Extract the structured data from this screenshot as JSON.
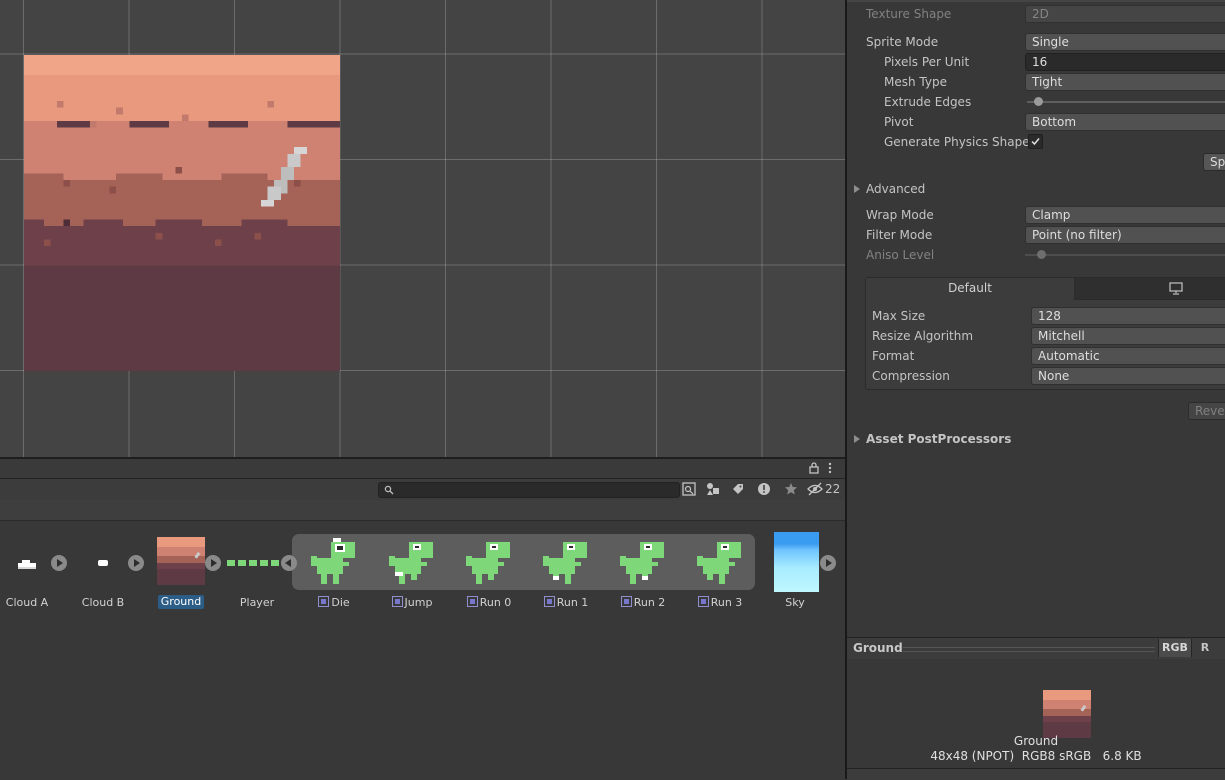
{
  "inspector": {
    "texture_shape_label": "Texture Shape",
    "texture_shape_value": "2D",
    "sprite_mode_label": "Sprite Mode",
    "sprite_mode_value": "Single",
    "ppu_label": "Pixels Per Unit",
    "ppu_value": "16",
    "mesh_type_label": "Mesh Type",
    "mesh_type_value": "Tight",
    "extrude_label": "Extrude Edges",
    "pivot_label": "Pivot",
    "pivot_value": "Bottom",
    "physics_shape_label": "Generate Physics Shape",
    "physics_shape_checked": true,
    "sprite_editor_button": "Sp",
    "advanced_label": "Advanced",
    "wrap_mode_label": "Wrap Mode",
    "wrap_mode_value": "Clamp",
    "filter_mode_label": "Filter Mode",
    "filter_mode_value": "Point (no filter)",
    "aniso_label": "Aniso Level",
    "platform_tab_default": "Default",
    "max_size_label": "Max Size",
    "max_size_value": "128",
    "resize_label": "Resize Algorithm",
    "resize_value": "Mitchell",
    "format_label": "Format",
    "format_value": "Automatic",
    "compression_label": "Compression",
    "compression_value": "None",
    "revert_button": "Rever",
    "postprocessors_label": "Asset PostProcessors"
  },
  "preview": {
    "title": "Ground",
    "rgb_button": "RGB",
    "r_button": "R",
    "asset_name": "Ground",
    "info": "48x48 (NPOT)  RGB8 sRGB   6.8 KB"
  },
  "project": {
    "hidden_count": "22",
    "search_placeholder": "",
    "assets": [
      {
        "label": "Cloud A"
      },
      {
        "label": "Cloud B"
      },
      {
        "label": "Ground"
      },
      {
        "label": "Player"
      },
      {
        "label": "Sky"
      }
    ],
    "sub_sprites": [
      "Die",
      "Jump",
      "Run 0",
      "Run 1",
      "Run 2",
      "Run 3"
    ]
  },
  "colors": {
    "selection": "#2c5d87",
    "ground_top": "#e99a7e",
    "ground_mid": "#c77d6f",
    "ground_low": "#9a5c52",
    "ground_bottom": "#5e3a44",
    "dino_green": "#7ed87a"
  }
}
